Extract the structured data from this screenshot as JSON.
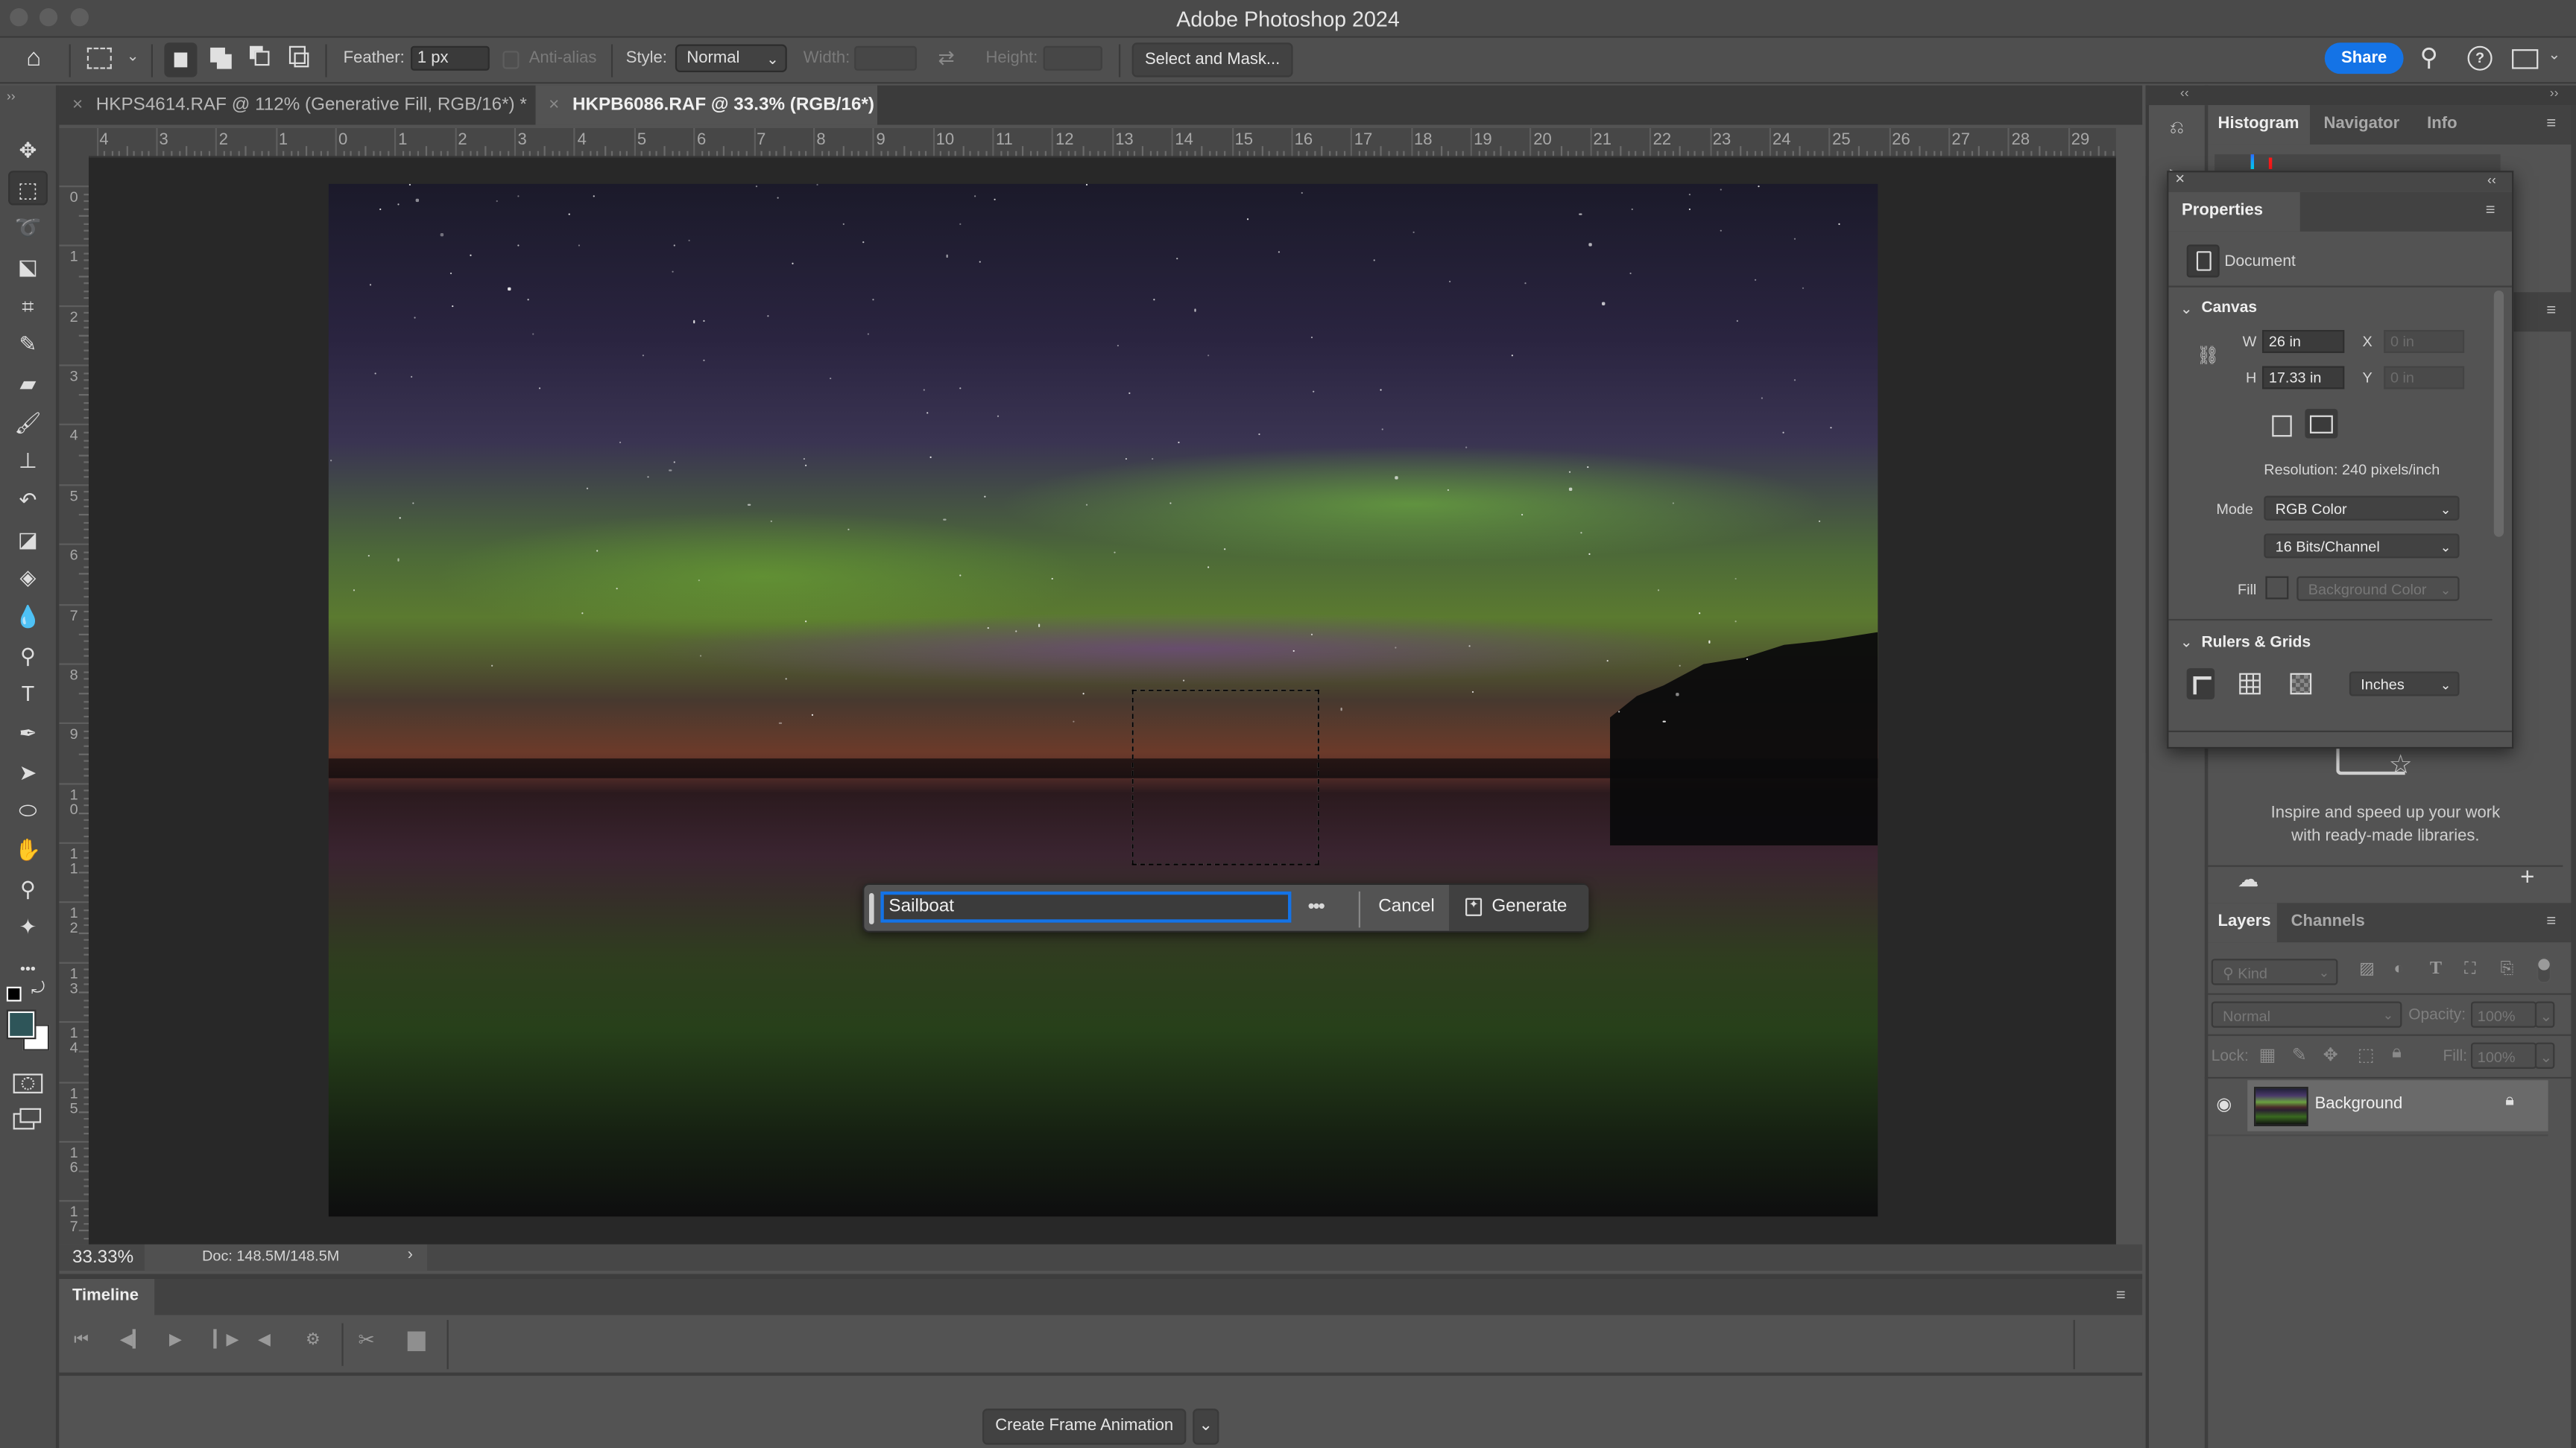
{
  "window": {
    "title": "Adobe Photoshop 2024"
  },
  "options_bar": {
    "feather_label": "Feather:",
    "feather_value": "1 px",
    "anti_alias_label": "Anti-alias",
    "style_label": "Style:",
    "style_value": "Normal",
    "width_label": "Width:",
    "width_value": "",
    "height_label": "Height:",
    "height_value": "",
    "select_and_mask_label": "Select and Mask...",
    "share_label": "Share"
  },
  "doc_tabs": [
    {
      "label": "HKPS4614.RAF @ 112% (Generative Fill, RGB/16*) *",
      "active": false
    },
    {
      "label": "HKPB6086.RAF @ 33.3% (RGB/16*) *",
      "active": true
    }
  ],
  "tools": [
    {
      "name": "move-tool",
      "glyph": "✥"
    },
    {
      "name": "rectangular-marquee-tool",
      "glyph": "⬚",
      "active": true
    },
    {
      "name": "lasso-tool",
      "glyph": "➰"
    },
    {
      "name": "object-selection-tool",
      "glyph": "⬕"
    },
    {
      "name": "crop-tool",
      "glyph": "⌗"
    },
    {
      "name": "eyedropper-tool",
      "glyph": "✎"
    },
    {
      "name": "spot-healing-tool",
      "glyph": "▰"
    },
    {
      "name": "brush-tool",
      "glyph": "🖌"
    },
    {
      "name": "clone-stamp-tool",
      "glyph": "⊥"
    },
    {
      "name": "history-brush-tool",
      "glyph": "↶"
    },
    {
      "name": "eraser-tool",
      "glyph": "◪"
    },
    {
      "name": "paint-bucket-tool",
      "glyph": "◈"
    },
    {
      "name": "blur-tool",
      "glyph": "💧"
    },
    {
      "name": "dodge-tool",
      "glyph": "⚲"
    },
    {
      "name": "type-tool",
      "glyph": "T"
    },
    {
      "name": "pen-tool",
      "glyph": "✒"
    },
    {
      "name": "path-selection-tool",
      "glyph": "➤"
    },
    {
      "name": "ellipse-tool",
      "glyph": "⬭"
    },
    {
      "name": "hand-tool",
      "glyph": "✋"
    },
    {
      "name": "zoom-tool",
      "glyph": "⚲"
    },
    {
      "name": "remove-tool",
      "glyph": "✦"
    },
    {
      "name": "edit-toolbar",
      "glyph": "•••"
    }
  ],
  "colors": {
    "foreground": "#2e5559",
    "background": "#ffffff",
    "accent": "#1473e6"
  },
  "ruler": {
    "top": [
      "4",
      "3",
      "2",
      "1",
      "0",
      "1",
      "2",
      "3",
      "4",
      "5",
      "6",
      "7",
      "8",
      "9",
      "10",
      "11",
      "12",
      "13",
      "14",
      "15",
      "16",
      "17",
      "18",
      "19",
      "20",
      "21",
      "22",
      "23",
      "24",
      "25",
      "26",
      "27",
      "28",
      "29"
    ],
    "left": [
      "0",
      "1",
      "2",
      "3",
      "4",
      "5",
      "6",
      "7",
      "8",
      "9",
      "10",
      "11",
      "12",
      "13",
      "14",
      "15",
      "16",
      "17"
    ]
  },
  "generative_fill": {
    "prompt_value": "Sailboat",
    "more_label": "•••",
    "cancel_label": "Cancel",
    "generate_label": "Generate"
  },
  "status": {
    "zoom": "33.33%",
    "doc": "Doc: 148.5M/148.5M",
    "arrow": "›"
  },
  "timeline": {
    "tab_label": "Timeline",
    "create_label": "Create Frame Animation"
  },
  "top_panel": {
    "tabs": [
      "Histogram",
      "Navigator",
      "Info"
    ]
  },
  "properties": {
    "tab_label": "Properties",
    "kind_label": "Document",
    "canvas_label": "Canvas",
    "w_label": "W",
    "w_value": "26 in",
    "h_label": "H",
    "h_value": "17.33 in",
    "x_label": "X",
    "x_value": "0 in",
    "y_label": "Y",
    "y_value": "0 in",
    "resolution": "Resolution: 240 pixels/inch",
    "mode_label": "Mode",
    "mode_value": "RGB Color",
    "bits_value": "16 Bits/Channel",
    "fill_label": "Fill",
    "fill_value": "Background Color",
    "rulers_label": "Rulers & Grids",
    "units_value": "Inches"
  },
  "libraries": {
    "message_line1": "Inspire and speed up your work",
    "message_line2": "with ready-made libraries."
  },
  "layers_panel": {
    "tabs": [
      "Layers",
      "Channels"
    ],
    "filter_label": "Kind",
    "blend_mode": "Normal",
    "opacity_label": "Opacity:",
    "opacity_value": "100%",
    "lock_label": "Lock:",
    "fill_label": "Fill:",
    "fill_value": "100%",
    "layers": [
      {
        "name": "Background",
        "visible": true,
        "locked": true
      }
    ]
  }
}
